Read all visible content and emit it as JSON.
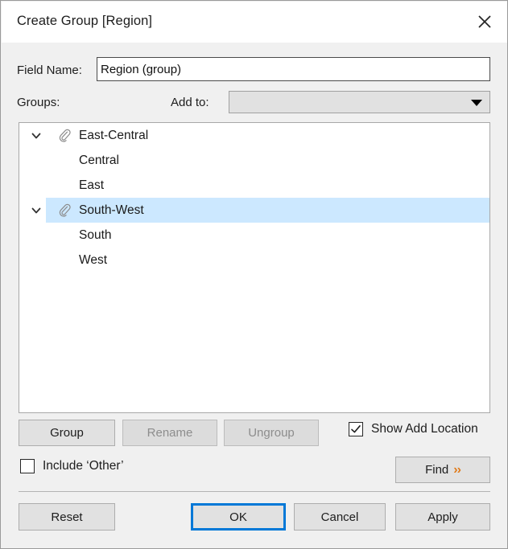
{
  "window": {
    "title": "Create Group [Region]",
    "close_icon": "close-icon"
  },
  "form": {
    "field_name_label": "Field Name:",
    "field_name_value": "Region (group)",
    "field_name_placeholder": "",
    "groups_label": "Groups:",
    "add_to_label": "Add to:",
    "add_to_value": "",
    "add_to_arrow_icon": "chevron-down-icon"
  },
  "tree": {
    "rows": [
      {
        "label": "East-Central",
        "type": "group",
        "expanded": true,
        "selected": false
      },
      {
        "label": "Central",
        "type": "member",
        "expanded": false,
        "selected": false
      },
      {
        "label": "East",
        "type": "member",
        "expanded": false,
        "selected": false
      },
      {
        "label": "South-West",
        "type": "group",
        "expanded": true,
        "selected": true
      },
      {
        "label": "South",
        "type": "member",
        "expanded": false,
        "selected": false
      },
      {
        "label": "West",
        "type": "member",
        "expanded": false,
        "selected": false
      }
    ],
    "group_icon": "paperclip-icon",
    "expand_icon": "chevron-down-icon",
    "selection_color": "#cce8ff"
  },
  "actions": {
    "group": "Group",
    "rename": "Rename",
    "ungroup": "Ungroup",
    "rename_enabled": false,
    "ungroup_enabled": false,
    "find": "Find",
    "find_chevrons": "››",
    "find_chevron_color": "#e07b1a"
  },
  "options": {
    "show_add_location_label": "Show Add Location",
    "show_add_location_checked": true,
    "include_other_label": "Include ‘Other’",
    "include_other_checked": false
  },
  "footer": {
    "reset": "Reset",
    "ok": "OK",
    "cancel": "Cancel",
    "apply": "Apply",
    "focus_color": "#0078d7"
  }
}
